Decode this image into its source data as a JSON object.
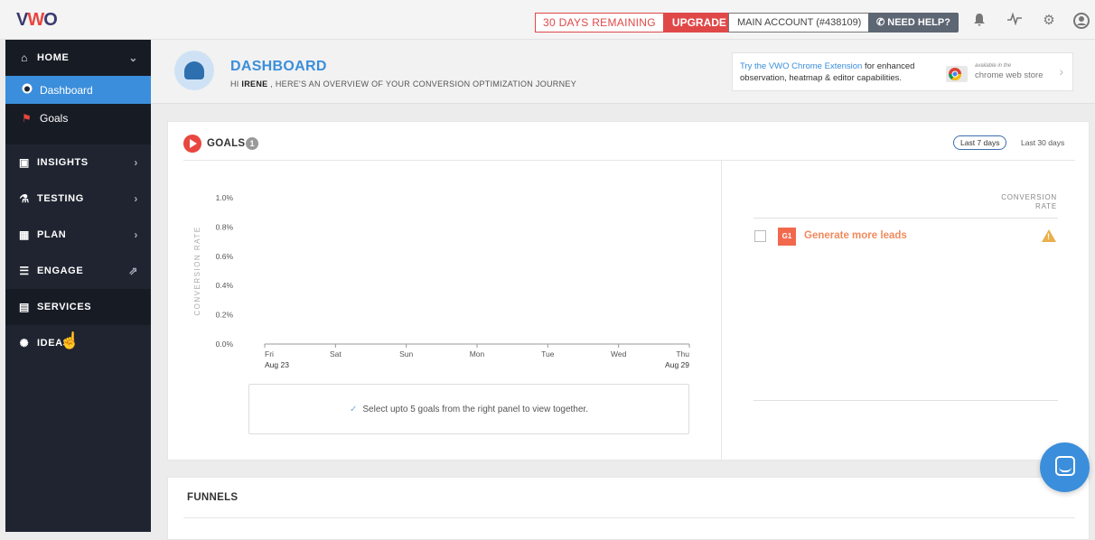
{
  "topbar": {
    "logo": "VWO",
    "trial_remaining": "30 DAYS REMAINING",
    "upgrade_label": "UPGRADE",
    "account_label": "MAIN ACCOUNT (#438109)",
    "help_label": "NEED HELP?",
    "icons": [
      "bell-icon",
      "activity-icon",
      "gear-icon",
      "user-icon"
    ]
  },
  "sidebar": {
    "home": "HOME",
    "dashboard": "Dashboard",
    "goals": "Goals",
    "insights": "INSIGHTS",
    "testing": "TESTING",
    "plan": "PLAN",
    "engage": "ENGAGE",
    "services": "SERVICES",
    "ideas": "IDEAS"
  },
  "header": {
    "title": "DASHBOARD",
    "greeting_prefix": "HI",
    "user": "IRENE",
    "greeting_suffix": ", HERE'S AN OVERVIEW OF YOUR CONVERSION OPTIMIZATION JOURNEY",
    "ext_link": "Try the VWO Chrome Extension",
    "ext_text": " for enhanced observation, heatmap & editor capabilities.",
    "ext_available": "available in the",
    "ext_store": "chrome web store"
  },
  "goals": {
    "title": "GOALS",
    "count": "1",
    "range_7": "Last 7 days",
    "range_30": "Last 30 days",
    "hint": "Select upto 5 goals from the right panel to view together.",
    "conversion_header": "CONVERSION RATE",
    "items": [
      {
        "tag": "G1",
        "name": "Generate more leads"
      }
    ]
  },
  "funnels": {
    "title": "FUNNELS"
  },
  "chart_data": {
    "type": "line",
    "ylabel": "CONVERSION RATE",
    "y_ticks": [
      "1.0%",
      "0.8%",
      "0.6%",
      "0.4%",
      "0.2%",
      "0.0%"
    ],
    "ylim": [
      0,
      1.0
    ],
    "categories": [
      "Fri",
      "Sat",
      "Sun",
      "Mon",
      "Tue",
      "Wed",
      "Thu"
    ],
    "date_start": "Aug 23",
    "date_end": "Aug 29",
    "series": []
  }
}
